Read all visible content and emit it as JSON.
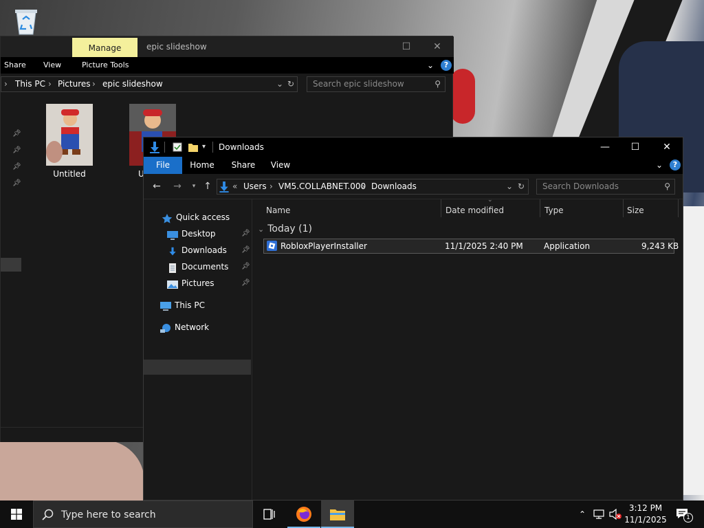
{
  "desktop": {
    "recycle_bin_icon": "recycle-bin-icon"
  },
  "back_window": {
    "ribbon_context_tab": "Manage",
    "title": "epic slideshow",
    "ribbon_tabs": [
      "Share",
      "View",
      "Picture Tools"
    ],
    "breadcrumb": [
      "This PC",
      "Pictures",
      "epic slideshow"
    ],
    "search_placeholder": "Search epic slideshow",
    "thumbnails": [
      {
        "label": "Untitled"
      },
      {
        "label": "U"
      }
    ]
  },
  "front_window": {
    "title": "Downloads",
    "ribbon_tabs": {
      "file": "File",
      "home": "Home",
      "share": "Share",
      "view": "View"
    },
    "address": {
      "chevron": "«",
      "segments": [
        "Users",
        "VM5.COLLABNET.000",
        "Downloads"
      ]
    },
    "search_placeholder": "Search Downloads",
    "nav_pane": {
      "quick_access": "Quick access",
      "desktop": "Desktop",
      "downloads": "Downloads",
      "documents": "Documents",
      "pictures": "Pictures",
      "this_pc": "This PC",
      "network": "Network"
    },
    "columns": {
      "name": "Name",
      "date_modified": "Date modified",
      "type": "Type",
      "size": "Size"
    },
    "group_header": "Today (1)",
    "files": [
      {
        "name": "RobloxPlayerInstaller",
        "date_modified": "11/1/2025 2:40 PM",
        "type": "Application",
        "size": "9,243 KB"
      }
    ]
  },
  "taskbar": {
    "search_text": "Type here to search",
    "time": "3:12 PM",
    "date": "11/1/2025",
    "notification_count": "1"
  },
  "colors": {
    "accent": "#1a6fc9",
    "manage_tab": "#f4f09c",
    "window_bg": "#191919",
    "taskbar_bg": "#101010",
    "active_indicator": "#76b9ed"
  }
}
